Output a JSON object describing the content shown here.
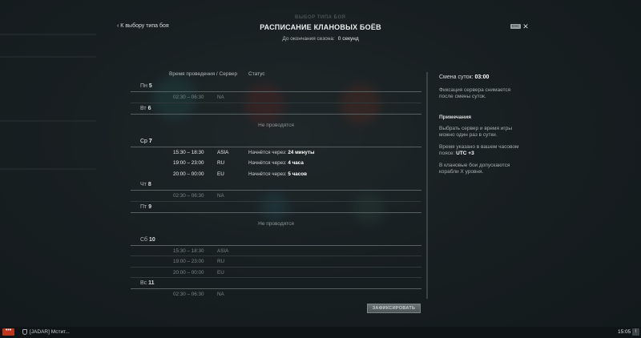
{
  "header": {
    "back_label": "К выбору типа боя",
    "ghost_title": "ВЫБОР ТИПА БОЯ",
    "title": "РАСПИСАНИЕ КЛАНОВЫХ БОЁВ",
    "season_label": "До окончания сезона:",
    "season_value": "0 секунд",
    "esc_label": "ESC"
  },
  "columns": {
    "time_server": "Время проведения / Сервер",
    "status": "Статус"
  },
  "schedule": {
    "days": [
      {
        "dow": "Пн",
        "num": "5",
        "rows": [
          {
            "time": "02:30 – 06:30",
            "server": "NA",
            "status_prefix": "",
            "status_value": ""
          }
        ]
      },
      {
        "dow": "Вт",
        "num": "6",
        "not_held": "Не проводятся"
      },
      {
        "dow": "Ср",
        "num": "7",
        "rows": [
          {
            "time": "15:30 – 18:30",
            "server": "ASIA",
            "status_prefix": "Начнётся через:",
            "status_value": "24 минуты"
          },
          {
            "time": "19:00 – 23:00",
            "server": "RU",
            "status_prefix": "Начнётся через:",
            "status_value": "4 часа"
          },
          {
            "time": "20:00 – 00:00",
            "server": "EU",
            "status_prefix": "Начнётся через:",
            "status_value": "5 часов"
          }
        ]
      },
      {
        "dow": "Чт",
        "num": "8",
        "rows": [
          {
            "time": "02:30 – 06:30",
            "server": "NA"
          }
        ]
      },
      {
        "dow": "Пт",
        "num": "9",
        "not_held": "Не проводятся"
      },
      {
        "dow": "Сб",
        "num": "10",
        "rows": [
          {
            "time": "15:30 – 18:30",
            "server": "ASIA"
          },
          {
            "time": "19:00 – 23:00",
            "server": "RU"
          },
          {
            "time": "20:00 – 00:00",
            "server": "EU"
          }
        ]
      },
      {
        "dow": "Вс",
        "num": "11",
        "rows": [
          {
            "time": "02:30 – 06:30",
            "server": "NA"
          }
        ]
      }
    ]
  },
  "fix_button": "ЗАФИКСИРОВАТЬ",
  "right_panel": {
    "shift_label": "Смена суток:",
    "shift_value": "03:00",
    "server_note": "Фиксация сервера снимается после смены суток.",
    "notes_heading": "Примечания",
    "note1": "Выбрать сервер и время игры можно один раз в сутки.",
    "note2_prefix": "Время указано в вашем часовом поясе:",
    "note2_value": "UTC +3",
    "note3": "В клановые бои допускаются корабли X уровня."
  },
  "bottom_bar": {
    "menu_label": "•••",
    "clan_label": "[JADAR] Мстит...",
    "clock": "15:05",
    "info_label": "i"
  },
  "colors": {
    "background": "#1d2628",
    "menu_button": "#c0361d",
    "row_divider": "#566062"
  }
}
